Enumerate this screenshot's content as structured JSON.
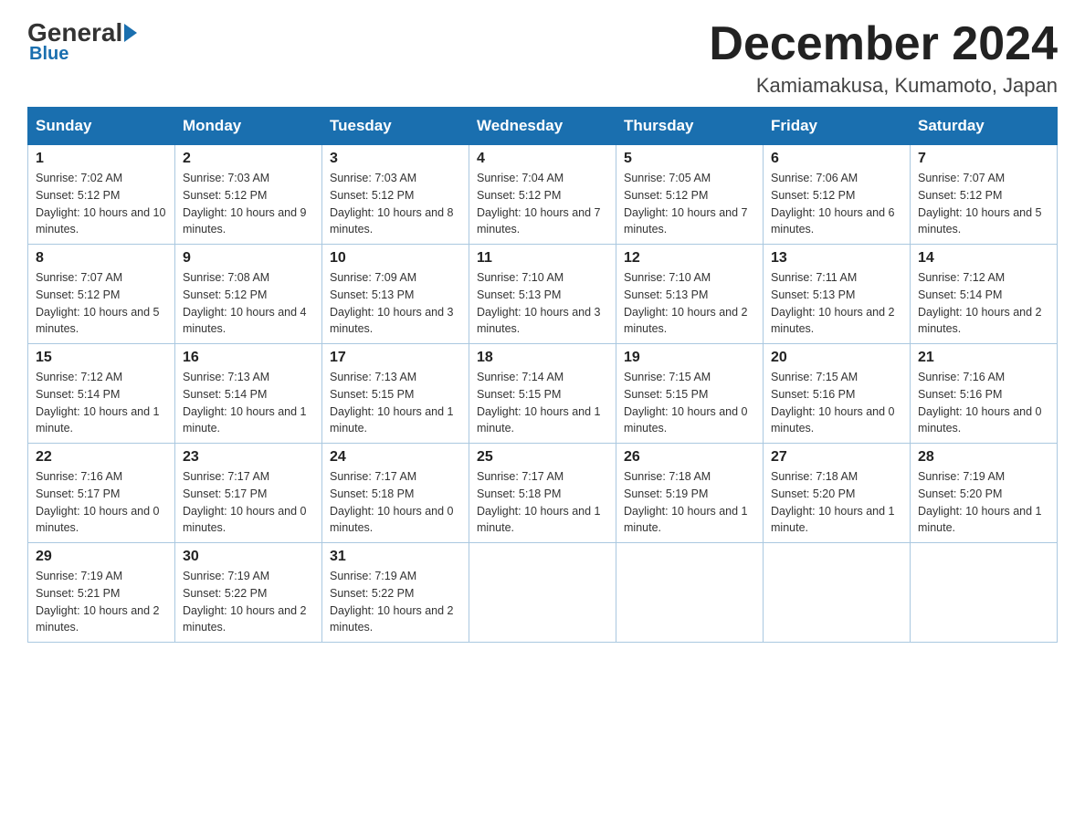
{
  "logo": {
    "general": "General",
    "blue": "Blue"
  },
  "title": "December 2024",
  "location": "Kamiamakusa, Kumamoto, Japan",
  "days_of_week": [
    "Sunday",
    "Monday",
    "Tuesday",
    "Wednesday",
    "Thursday",
    "Friday",
    "Saturday"
  ],
  "weeks": [
    [
      {
        "day": "1",
        "sunrise": "7:02 AM",
        "sunset": "5:12 PM",
        "daylight": "10 hours and 10 minutes."
      },
      {
        "day": "2",
        "sunrise": "7:03 AM",
        "sunset": "5:12 PM",
        "daylight": "10 hours and 9 minutes."
      },
      {
        "day": "3",
        "sunrise": "7:03 AM",
        "sunset": "5:12 PM",
        "daylight": "10 hours and 8 minutes."
      },
      {
        "day": "4",
        "sunrise": "7:04 AM",
        "sunset": "5:12 PM",
        "daylight": "10 hours and 7 minutes."
      },
      {
        "day": "5",
        "sunrise": "7:05 AM",
        "sunset": "5:12 PM",
        "daylight": "10 hours and 7 minutes."
      },
      {
        "day": "6",
        "sunrise": "7:06 AM",
        "sunset": "5:12 PM",
        "daylight": "10 hours and 6 minutes."
      },
      {
        "day": "7",
        "sunrise": "7:07 AM",
        "sunset": "5:12 PM",
        "daylight": "10 hours and 5 minutes."
      }
    ],
    [
      {
        "day": "8",
        "sunrise": "7:07 AM",
        "sunset": "5:12 PM",
        "daylight": "10 hours and 5 minutes."
      },
      {
        "day": "9",
        "sunrise": "7:08 AM",
        "sunset": "5:12 PM",
        "daylight": "10 hours and 4 minutes."
      },
      {
        "day": "10",
        "sunrise": "7:09 AM",
        "sunset": "5:13 PM",
        "daylight": "10 hours and 3 minutes."
      },
      {
        "day": "11",
        "sunrise": "7:10 AM",
        "sunset": "5:13 PM",
        "daylight": "10 hours and 3 minutes."
      },
      {
        "day": "12",
        "sunrise": "7:10 AM",
        "sunset": "5:13 PM",
        "daylight": "10 hours and 2 minutes."
      },
      {
        "day": "13",
        "sunrise": "7:11 AM",
        "sunset": "5:13 PM",
        "daylight": "10 hours and 2 minutes."
      },
      {
        "day": "14",
        "sunrise": "7:12 AM",
        "sunset": "5:14 PM",
        "daylight": "10 hours and 2 minutes."
      }
    ],
    [
      {
        "day": "15",
        "sunrise": "7:12 AM",
        "sunset": "5:14 PM",
        "daylight": "10 hours and 1 minute."
      },
      {
        "day": "16",
        "sunrise": "7:13 AM",
        "sunset": "5:14 PM",
        "daylight": "10 hours and 1 minute."
      },
      {
        "day": "17",
        "sunrise": "7:13 AM",
        "sunset": "5:15 PM",
        "daylight": "10 hours and 1 minute."
      },
      {
        "day": "18",
        "sunrise": "7:14 AM",
        "sunset": "5:15 PM",
        "daylight": "10 hours and 1 minute."
      },
      {
        "day": "19",
        "sunrise": "7:15 AM",
        "sunset": "5:15 PM",
        "daylight": "10 hours and 0 minutes."
      },
      {
        "day": "20",
        "sunrise": "7:15 AM",
        "sunset": "5:16 PM",
        "daylight": "10 hours and 0 minutes."
      },
      {
        "day": "21",
        "sunrise": "7:16 AM",
        "sunset": "5:16 PM",
        "daylight": "10 hours and 0 minutes."
      }
    ],
    [
      {
        "day": "22",
        "sunrise": "7:16 AM",
        "sunset": "5:17 PM",
        "daylight": "10 hours and 0 minutes."
      },
      {
        "day": "23",
        "sunrise": "7:17 AM",
        "sunset": "5:17 PM",
        "daylight": "10 hours and 0 minutes."
      },
      {
        "day": "24",
        "sunrise": "7:17 AM",
        "sunset": "5:18 PM",
        "daylight": "10 hours and 0 minutes."
      },
      {
        "day": "25",
        "sunrise": "7:17 AM",
        "sunset": "5:18 PM",
        "daylight": "10 hours and 1 minute."
      },
      {
        "day": "26",
        "sunrise": "7:18 AM",
        "sunset": "5:19 PM",
        "daylight": "10 hours and 1 minute."
      },
      {
        "day": "27",
        "sunrise": "7:18 AM",
        "sunset": "5:20 PM",
        "daylight": "10 hours and 1 minute."
      },
      {
        "day": "28",
        "sunrise": "7:19 AM",
        "sunset": "5:20 PM",
        "daylight": "10 hours and 1 minute."
      }
    ],
    [
      {
        "day": "29",
        "sunrise": "7:19 AM",
        "sunset": "5:21 PM",
        "daylight": "10 hours and 2 minutes."
      },
      {
        "day": "30",
        "sunrise": "7:19 AM",
        "sunset": "5:22 PM",
        "daylight": "10 hours and 2 minutes."
      },
      {
        "day": "31",
        "sunrise": "7:19 AM",
        "sunset": "5:22 PM",
        "daylight": "10 hours and 2 minutes."
      },
      null,
      null,
      null,
      null
    ]
  ],
  "labels": {
    "sunrise": "Sunrise:",
    "sunset": "Sunset:",
    "daylight": "Daylight:"
  }
}
